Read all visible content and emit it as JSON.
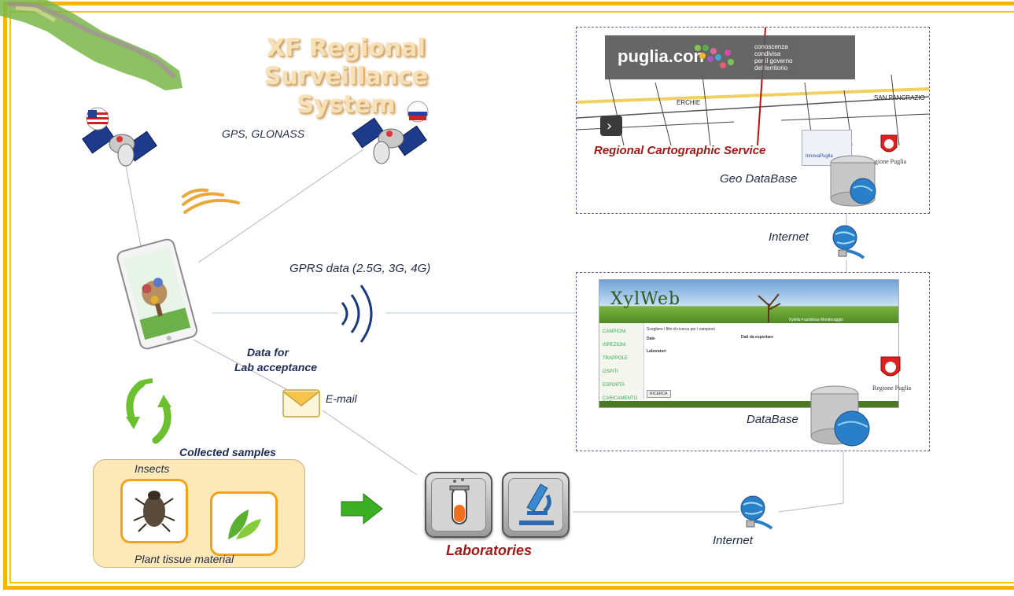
{
  "title": {
    "line1": "XF Regional",
    "line2": "Surveillance System"
  },
  "labels": {
    "gps": "GPS, GLONASS",
    "gprs": "GPRS  data (2.5G, 3G, 4G)",
    "data_for": "Data for",
    "lab_acceptance": "Lab acceptance",
    "email": "E-mail",
    "collected_samples": "Collected samples",
    "insects": "Insects",
    "plant_tissue": "Plant tissue material",
    "laboratories": "Laboratories",
    "internet_top": "Internet",
    "internet_bottom": "Internet",
    "regional_cartographic": "Regional Cartographic Service",
    "geo_database": "Geo DataBase",
    "database": "DataBase"
  },
  "cartography_panel": {
    "banner_brand": "puglia.con",
    "banner_tagline": [
      "conoscenza",
      "condivisa",
      "per il governo",
      "del territorio"
    ],
    "map_labels": [
      "ERCHIE",
      "SAN PANCRAZIO"
    ],
    "logo_left": "InnovaPuglia",
    "logo_right": "Regione Puglia"
  },
  "xylweb_panel": {
    "app_title": "XylWeb",
    "header_strip": "Xylella Fastidiosa Monitoraggio",
    "sidebar": [
      "CAMPIONI",
      "ISPEZIONI",
      "TRAPPOLE",
      "OSPITI",
      "ESPORTA",
      "CARICAMENTO DATI"
    ],
    "content_heading": "Scegliere i filtri di ricerca per i campioni",
    "date_label": "Date",
    "lab_label": "Laboratori",
    "export_label": "Dati da esportare",
    "search_button": "RICERCA",
    "logo_right": "Regione Puglia"
  },
  "colors": {
    "frame": "#f5b800",
    "label_text": "#1f2a44",
    "accent_red": "#a01818",
    "arrow_green": "#3cb023"
  },
  "icons": [
    "satellite-icon",
    "us-flag-icon",
    "russia-flag-icon",
    "signal-waves-icon",
    "tablet-icon",
    "recycle-icon",
    "envelope-icon",
    "arrow-right-icon",
    "test-tube-icon",
    "microscope-icon",
    "globe-network-icon",
    "database-icon",
    "insect-icon",
    "leaf-icon",
    "region-map-icon"
  ]
}
